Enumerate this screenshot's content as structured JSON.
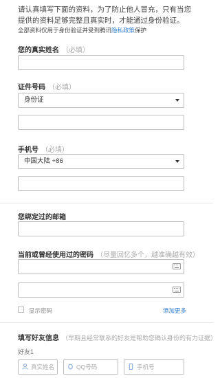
{
  "intro": {
    "text": "请认真填写下面的资料，为了防止他人冒充，只有当您提供的资料足够完整且真实时，才能通过身份验证。"
  },
  "privacy": {
    "text_before": "全部资料仅用于身份验证并受到腾讯",
    "link": "隐私政策",
    "text_after": "保护"
  },
  "name_section": {
    "label": "您的真实姓名",
    "hint": "（必填）"
  },
  "id_section": {
    "label": "证件号码",
    "hint": "（必填）",
    "type_selected": "身份证"
  },
  "phone_section": {
    "label": "手机号",
    "hint": "（必填）",
    "region_selected": "中国大陆 +86"
  },
  "email_section": {
    "label": "您绑定过的邮箱"
  },
  "password_section": {
    "label": "当前或曾经使用过的密码",
    "hint": "（尽量回忆多个，越准确越有效）",
    "show_password": "显示密码",
    "add_more": "添加更多"
  },
  "friends_section": {
    "label": "填写好友信息",
    "hint": "（早期且经常联系的好友是帮助您确认身份的有力证据）",
    "friend1": "好友1",
    "name_placeholder": "真实姓名",
    "qq_placeholder": "QQ号码",
    "phone_placeholder": "手机号"
  },
  "colors": {
    "link": "#2d7bd1",
    "border": "#bdbdbd",
    "hint": "#aaaaaa"
  }
}
